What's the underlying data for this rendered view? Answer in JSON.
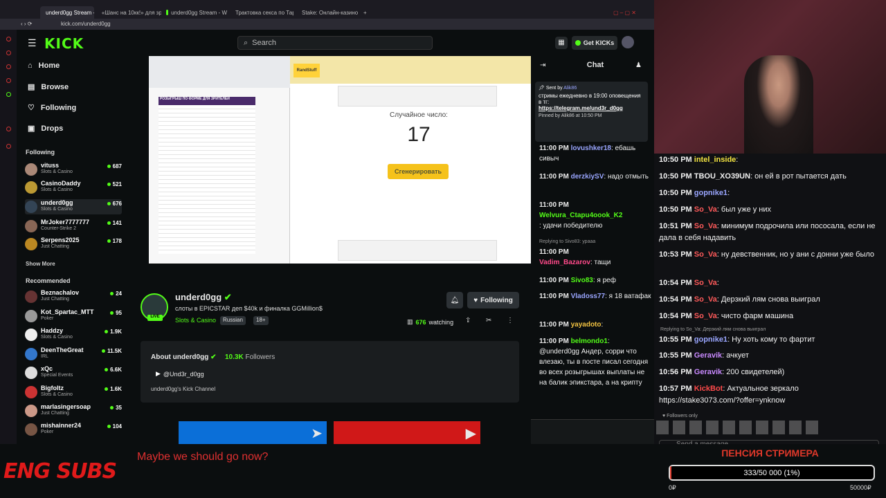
{
  "browser": {
    "tabs": [
      "underd0gg Stream - Wa",
      "«Шанс на 10кк!» для зрит",
      "underd0gg Stream - W",
      "Трактовка секса по Таро",
      "Stake: Онлайн-казино и с"
    ],
    "url": "kick.com/underd0gg"
  },
  "header": {
    "logo": "KICK",
    "search_placeholder": "Search",
    "get_kicks": "Get KICKs"
  },
  "nav": {
    "home": "Home",
    "browse": "Browse",
    "following": "Following",
    "drops": "Drops"
  },
  "sidebar": {
    "following_title": "Following",
    "following": [
      {
        "name": "vituss",
        "category": "Slots & Casino",
        "viewers": "687"
      },
      {
        "name": "CasinoDaddy",
        "category": "Slots & Casino",
        "viewers": "521"
      },
      {
        "name": "underd0gg",
        "category": "Slots & Casino",
        "viewers": "676"
      },
      {
        "name": "MrJoker7777777",
        "category": "Counter-Strike 2",
        "viewers": "141"
      },
      {
        "name": "Serpens2025",
        "category": "Just Chatting",
        "viewers": "178"
      }
    ],
    "show_more": "Show More",
    "recommended_title": "Recommended",
    "recommended": [
      {
        "name": "Beznachalov",
        "category": "Just Chatting",
        "viewers": "24"
      },
      {
        "name": "Kot_Spartac_MTT",
        "category": "Poker",
        "viewers": "95"
      },
      {
        "name": "Haddzy",
        "category": "Slots & Casino",
        "viewers": "1.9K"
      },
      {
        "name": "DeenTheGreat",
        "category": "IRL",
        "viewers": "11.5K"
      },
      {
        "name": "xQc",
        "category": "Special Events",
        "viewers": "6.6K"
      },
      {
        "name": "Bigfoltz",
        "category": "Slots & Casino",
        "viewers": "1.6K"
      },
      {
        "name": "marlasingersoap",
        "category": "Just Chatting",
        "viewers": "35"
      },
      {
        "name": "mishainner24",
        "category": "Poker",
        "viewers": "104"
      }
    ]
  },
  "player": {
    "sheet_title": "РОЗЫГРЫШ ПО ФОРМЕ ДЛЯ ЗРИТЕЛЕЙ",
    "site_name": "RandStuff",
    "random_label": "Случайное число:",
    "random_number": "17",
    "generate_button": "Сгенерировать"
  },
  "channel": {
    "name": "underd0gg",
    "live": "LIVE",
    "title": "слоты в EPICSTAR деп $40k и финалка GGMillion$",
    "category": "Slots & Casino",
    "tags": [
      "Russian",
      "18+"
    ],
    "following_button": "Following",
    "watching_count": "676",
    "watching_label": "watching",
    "about_title": "About underd0gg",
    "followers_count": "10.3K",
    "followers_label": "Followers",
    "youtube": "@Und3r_d0gg",
    "description": "underd0gg's Kick Channel"
  },
  "kick_chat": {
    "title": "Chat",
    "pinned": {
      "sent_by": "Sent by",
      "sender": "Alik86",
      "text": "стримы ежедневно в 19:00 оповещения в тг:",
      "link": "https://telegram.me/und3r_d0gg",
      "pinned_by": "Pinned by Alik86 at 10:50 PM"
    },
    "messages": [
      {
        "time": "11:00 PM",
        "user": "lovushker18",
        "color": "#9aa6ff",
        "text": ": ебашь сивыч"
      },
      {
        "time": "11:00 PM",
        "user": "derzkiySV",
        "color": "#9aa6ff",
        "text": ": надо отмыть"
      },
      {
        "time": "11:00 PM",
        "user": "Welvura_Ctapu4oook_K2",
        "color": "#53fc18",
        "text": ": удачи победителю"
      },
      {
        "time": "11:00 PM",
        "user": "Vadim_Bazarov",
        "color": "#ff4a8a",
        "text": ": тащи"
      },
      {
        "time": "11:00 PM",
        "user": "Sivo83",
        "color": "#53fc18",
        "text": ": я реф"
      },
      {
        "time": "11:00 PM",
        "user": "Vladoss77",
        "color": "#9aa6ff",
        "text": ": я 18 ватафак"
      },
      {
        "time": "11:00 PM",
        "user": "yayadoto",
        "color": "#f5c542",
        "text": ":"
      },
      {
        "time": "11:00 PM",
        "user": "belmondo1",
        "color": "#53fc18",
        "text": ": @underd0gg Андер, сорри что влезаю, ты в посте писал сегодня во всех розыгрышах выплаты не на балик эпикстара, а на крипту"
      }
    ],
    "reply_note": "Replying to Sivo83: урааа"
  },
  "overlay_chat": {
    "messages": [
      {
        "time": "10:50 PM",
        "user": "intel_inside",
        "color": "#f5e642",
        "text": ":"
      },
      {
        "time": "10:50 PM",
        "user": "TBOU_XO39UN",
        "color": "#f2f2f2",
        "text": ": он ей в рот пытается дать"
      },
      {
        "time": "10:50 PM",
        "user": "gopnike1",
        "color": "#9aa6ff",
        "text": ":"
      },
      {
        "time": "10:50 PM",
        "user": "So_Va",
        "color": "#ff5a5a",
        "text": ": был уже у них"
      },
      {
        "time": "10:51 PM",
        "user": "So_Va",
        "color": "#ff5a5a",
        "text": ": минимум подрочила или пососала, если не дала в себя надавить"
      },
      {
        "time": "10:53 PM",
        "user": "So_Va",
        "color": "#ff5a5a",
        "text": ": ну девственник, но у ани с донни уже было"
      },
      {
        "time": "10:54 PM",
        "user": "So_Va",
        "color": "#ff5a5a",
        "text": ":"
      },
      {
        "time": "10:54 PM",
        "user": "So_Va",
        "color": "#ff5a5a",
        "text": ": Дерзкий лям снова выиграл"
      },
      {
        "time": "10:54 PM",
        "user": "So_Va",
        "color": "#ff5a5a",
        "text": ": чисто фарм машина"
      },
      {
        "time": "10:55 PM",
        "user": "gopnike1",
        "color": "#9aa6ff",
        "text": ": Ну хоть кому то фартит"
      },
      {
        "time": "10:55 PM",
        "user": "Geravik",
        "color": "#c98aff",
        "text": ": ачкует"
      },
      {
        "time": "10:56 PM",
        "user": "Geravik",
        "color": "#c98aff",
        "text": ": 200 свидетелей)"
      },
      {
        "time": "10:57 PM",
        "user": "KickBot",
        "color": "#ff4a4a",
        "text": ": Актуальное зеркало https://stake3073.com/?offer=ynknow"
      }
    ],
    "reply_note": "Replying to So_Va: Дерзкий лям снова выиграл",
    "followers_only": "Followers only",
    "send_placeholder": "Send a message"
  },
  "subs": {
    "brand": "ENG SUBS",
    "line": "Maybe we should go now?"
  },
  "pension": {
    "title": "ПЕНСИЯ СТРИМЕРА",
    "progress_text": "333/50 000 (1%)",
    "progress_fraction": 0.0067,
    "min": "0₽",
    "max": "50000₽"
  }
}
